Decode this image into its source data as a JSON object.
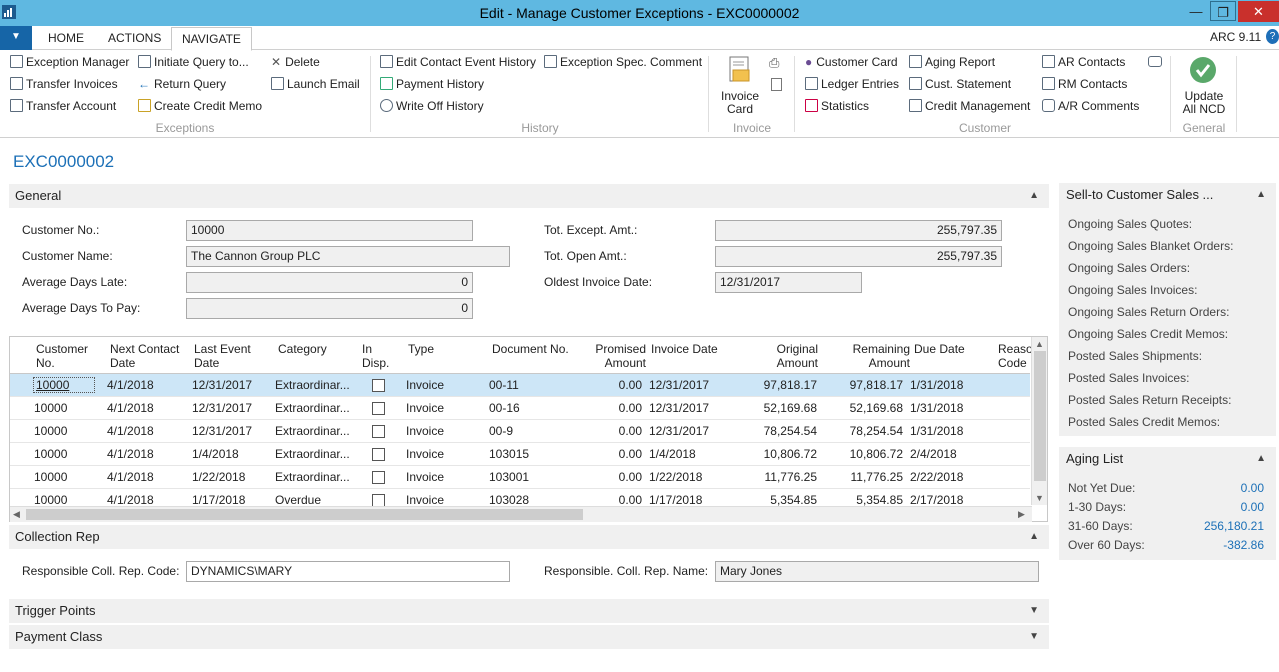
{
  "window": {
    "title": "Edit - Manage Customer Exceptions - EXC0000002",
    "version": "ARC 9.11"
  },
  "tabs": [
    "HOME",
    "ACTIONS",
    "NAVIGATE"
  ],
  "ribbon": {
    "exceptions": {
      "label": "Exceptions",
      "items": [
        "Exception Manager",
        "Transfer Invoices",
        "Transfer Account",
        "Initiate Query to...",
        "Return Query",
        "Create Credit Memo",
        "Delete",
        "Launch Email"
      ]
    },
    "history": {
      "label": "History",
      "items": [
        "Edit Contact Event History",
        "Payment History",
        "Write Off History",
        "Exception Spec. Comment"
      ]
    },
    "invoice": {
      "label": "Invoice",
      "big": "Invoice Card"
    },
    "customer": {
      "label": "Customer",
      "items": [
        "Customer Card",
        "Ledger Entries",
        "Statistics",
        "Aging Report",
        "Cust. Statement",
        "Credit Management",
        "AR Contacts",
        "RM Contacts",
        "A/R Comments"
      ]
    },
    "general": {
      "label": "General",
      "big": "Update All NCD"
    }
  },
  "page_title": "EXC0000002",
  "general": {
    "title": "General",
    "customer_no_label": "Customer No.:",
    "customer_no": "10000",
    "customer_name_label": "Customer Name:",
    "customer_name": "The Cannon Group PLC",
    "avg_days_late_label": "Average Days Late:",
    "avg_days_late": "0",
    "avg_days_pay_label": "Average Days To Pay:",
    "avg_days_pay": "0",
    "tot_except_label": "Tot. Except. Amt.:",
    "tot_except": "255,797.35",
    "tot_open_label": "Tot. Open Amt.:",
    "tot_open": "255,797.35",
    "oldest_label": "Oldest Invoice Date:",
    "oldest": "12/31/2017"
  },
  "grid": {
    "headers": [
      "Customer No.",
      "Next Contact Date",
      "Last Event Date",
      "Category",
      "In Disp.",
      "Type",
      "Document No.",
      "Promised Amount",
      "Invoice Date",
      "Original Amount",
      "Remaining Amount",
      "Due Date",
      "Reason Code"
    ],
    "rows": [
      [
        "10000",
        "4/1/2018",
        "12/31/2017",
        "Extraordinar...",
        "",
        "Invoice",
        "00-11",
        "0.00",
        "12/31/2017",
        "97,818.17",
        "97,818.17",
        "1/31/2018"
      ],
      [
        "10000",
        "4/1/2018",
        "12/31/2017",
        "Extraordinar...",
        "",
        "Invoice",
        "00-16",
        "0.00",
        "12/31/2017",
        "52,169.68",
        "52,169.68",
        "1/31/2018"
      ],
      [
        "10000",
        "4/1/2018",
        "12/31/2017",
        "Extraordinar...",
        "",
        "Invoice",
        "00-9",
        "0.00",
        "12/31/2017",
        "78,254.54",
        "78,254.54",
        "1/31/2018"
      ],
      [
        "10000",
        "4/1/2018",
        "1/4/2018",
        "Extraordinar...",
        "",
        "Invoice",
        "103015",
        "0.00",
        "1/4/2018",
        "10,806.72",
        "10,806.72",
        "2/4/2018"
      ],
      [
        "10000",
        "4/1/2018",
        "1/22/2018",
        "Extraordinar...",
        "",
        "Invoice",
        "103001",
        "0.00",
        "1/22/2018",
        "11,776.25",
        "11,776.25",
        "2/22/2018"
      ],
      [
        "10000",
        "4/1/2018",
        "1/17/2018",
        "Overdue",
        "",
        "Invoice",
        "103028",
        "0.00",
        "1/17/2018",
        "5,354.85",
        "5,354.85",
        "2/17/2018"
      ]
    ]
  },
  "collection": {
    "title": "Collection Rep",
    "code_label": "Responsible Coll. Rep. Code:",
    "code": "DYNAMICS\\MARY",
    "name_label": "Responsible. Coll. Rep. Name:",
    "name": "Mary Jones"
  },
  "trigger_points": "Trigger Points",
  "payment_class": "Payment Class",
  "sales_factbox": {
    "title": "Sell-to Customer Sales ...",
    "items": [
      "Ongoing Sales Quotes:",
      "Ongoing Sales Blanket Orders:",
      "Ongoing Sales Orders:",
      "Ongoing Sales Invoices:",
      "Ongoing Sales Return Orders:",
      "Ongoing Sales Credit Memos:",
      "Posted Sales Shipments:",
      "Posted Sales Invoices:",
      "Posted Sales Return Receipts:",
      "Posted Sales Credit Memos:"
    ]
  },
  "aging": {
    "title": "Aging List",
    "rows": [
      {
        "label": "Not Yet Due:",
        "value": "0.00"
      },
      {
        "label": "1-30 Days:",
        "value": "0.00"
      },
      {
        "label": "31-60 Days:",
        "value": "256,180.21"
      },
      {
        "label": "Over 60 Days:",
        "value": "-382.86"
      }
    ]
  }
}
